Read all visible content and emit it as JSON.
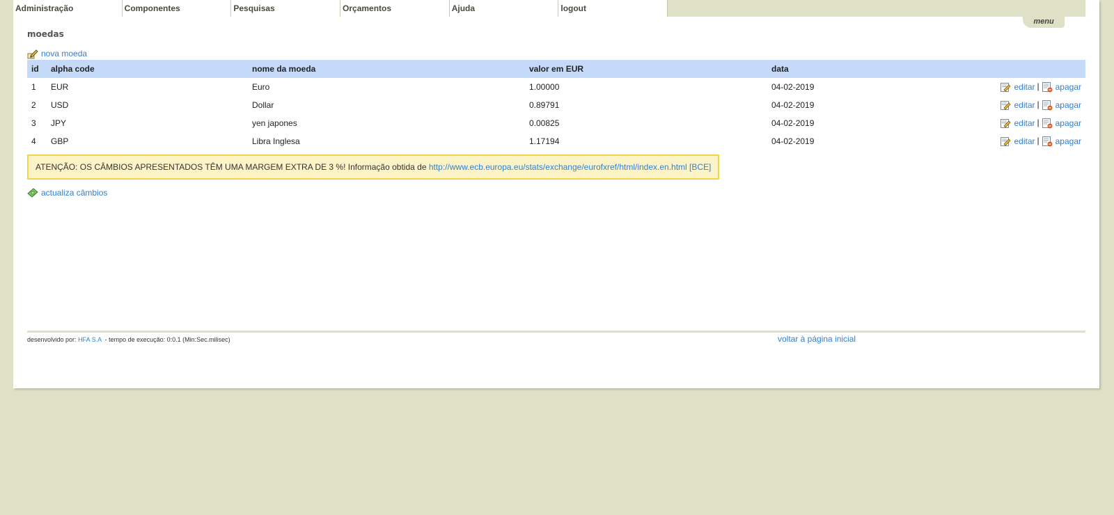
{
  "nav": {
    "items": [
      {
        "label": "Administração"
      },
      {
        "label": "Componentes"
      },
      {
        "label": "Pesquisas"
      },
      {
        "label": "Orçamentos"
      },
      {
        "label": "Ajuda"
      },
      {
        "label": "logout"
      }
    ],
    "menu_label": "menu"
  },
  "page": {
    "title": "moedas",
    "new_label": "nova moeda"
  },
  "table": {
    "columns": [
      "id",
      "alpha code",
      "nome da moeda",
      "valor em EUR",
      "data"
    ],
    "rows": [
      {
        "id": "1",
        "code": "EUR",
        "name": "Euro",
        "value": "1.00000",
        "date": "04-02-2019"
      },
      {
        "id": "2",
        "code": "USD",
        "name": "Dollar",
        "value": "0.89791",
        "date": "04-02-2019"
      },
      {
        "id": "3",
        "code": "JPY",
        "name": "yen japones",
        "value": "0.00825",
        "date": "04-02-2019"
      },
      {
        "id": "4",
        "code": "GBP",
        "name": "Libra Inglesa",
        "value": "1.17194",
        "date": "04-02-2019"
      }
    ],
    "edit_label": "editar",
    "delete_label": "apagar",
    "separator": "|"
  },
  "warning": {
    "text": "ATENÇÃO: OS CÂMBIOS APRESENTADOS TÊM UMA MARGEM EXTRA DE 3 %! Informação obtida de",
    "link": "http://www.ecb.europa.eu/stats/exchange/eurofxref/html/index.en.html [BCE]"
  },
  "update_label": "actualiza câmbios",
  "footer": {
    "dev_label": "desenvolvido por:",
    "company": "HFA S.A",
    "exec_time": "- tempo de execução: 0:0.1 (Min:Sec.milisec)",
    "home_link": "voltar à página inicial"
  },
  "colors": {
    "background": "#dee1c5",
    "header_row": "#c5d9f8",
    "link": "#2f7fd7",
    "warning_border": "#f6d44a",
    "warning_bg": "#fcf4c6"
  },
  "icons": {
    "new": "pencil-edit-icon",
    "edit": "edit-document-icon",
    "delete": "delete-document-icon",
    "update": "money-note-icon"
  }
}
